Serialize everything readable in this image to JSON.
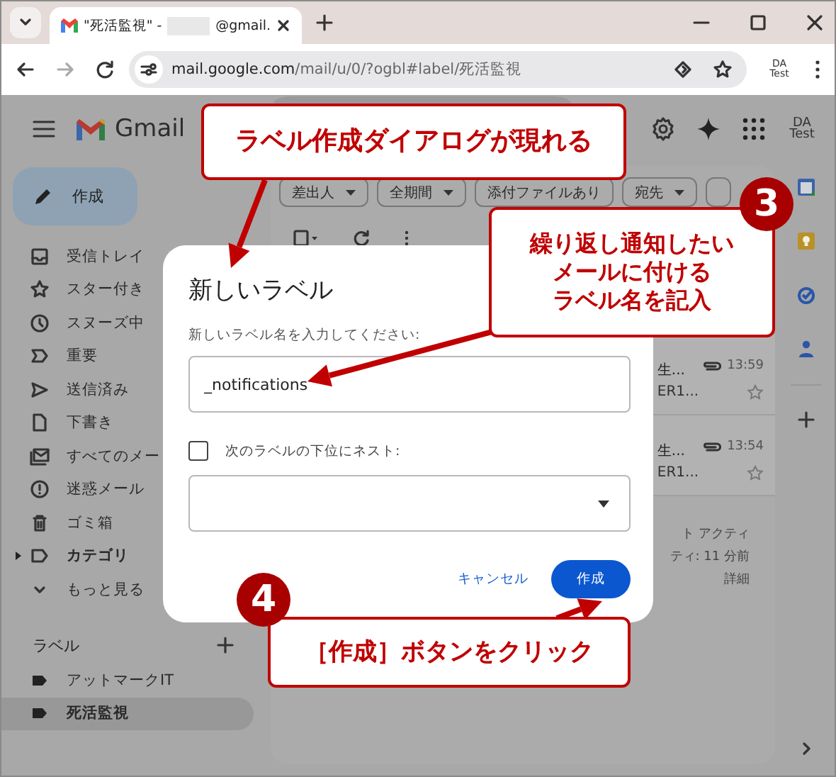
{
  "browser": {
    "tabs": [
      {
        "title_start": "\"死活監視\" - ",
        "title_end": "@gmail.",
        "selected": true
      }
    ],
    "url_host": "mail.google.com",
    "url_path": "/mail/u/0/?ogbl#label/死活監視",
    "profile": "DA Test"
  },
  "gmail": {
    "app_name": "Gmail",
    "account": "DA Test",
    "compose": "作成",
    "nav": [
      {
        "label": "受信トレイ",
        "kind": "folder",
        "selected": false
      },
      {
        "label": "スター付き",
        "kind": "folder",
        "selected": false
      },
      {
        "label": "スヌーズ中",
        "kind": "folder",
        "selected": false
      },
      {
        "label": "重要",
        "kind": "folder",
        "selected": false
      },
      {
        "label": "送信済み",
        "kind": "folder",
        "selected": false
      },
      {
        "label": "下書き",
        "kind": "folder",
        "selected": false
      },
      {
        "label": "すべてのメー",
        "kind": "folder",
        "selected": false
      },
      {
        "label": "迷惑メール",
        "kind": "folder",
        "selected": false
      },
      {
        "label": "ゴミ箱",
        "kind": "folder",
        "selected": false
      },
      {
        "label": "カテゴリ",
        "kind": "category",
        "selected": false
      },
      {
        "label": "もっと見る",
        "kind": "more",
        "selected": false
      }
    ],
    "labels_header": "ラベル",
    "labels": [
      {
        "label": "アットマークIT",
        "selected": false
      },
      {
        "label": "死活監視",
        "selected": true
      }
    ],
    "filters": [
      {
        "label": "差出人",
        "dropdown": true
      },
      {
        "label": "全期間",
        "dropdown": true
      },
      {
        "label": "添付ファイルあり",
        "dropdown": false
      },
      {
        "label": "宛先",
        "dropdown": true
      }
    ],
    "rows": [
      {
        "time": "13:59",
        "line_1": "生...",
        "line_2": "ER1...",
        "starred": false
      },
      {
        "time": "13:54",
        "line_1": "生...",
        "line_2": "ER1...",
        "starred": false
      }
    ],
    "activity": [
      "ト アクティ",
      "ティ: 11 分前",
      "詳細"
    ]
  },
  "dialog": {
    "title": "新しいラベル",
    "prompt": "新しいラベル名を入力してください:",
    "name_value": "_notifications",
    "nest_label": "次のラベルの下位にネスト:",
    "nest_checked": false,
    "cancel": "キャンセル",
    "create": "作成"
  },
  "callouts": [
    {
      "text": "ラベル作成ダイアログが現れる"
    },
    {
      "badge": "3",
      "lines": [
        "繰り返し通知したい",
        "メールに付ける",
        "ラベル名を記入"
      ]
    },
    {
      "badge": "4",
      "text": "［作成］ボタンをクリック"
    }
  ]
}
